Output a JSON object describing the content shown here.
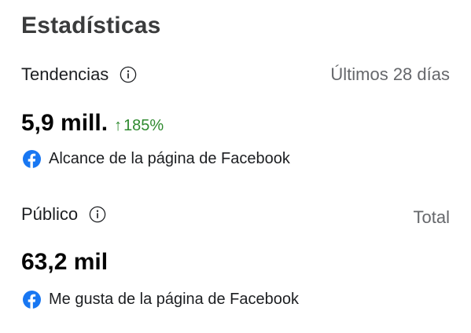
{
  "title": "Estadísticas",
  "trends": {
    "label": "Tendencias",
    "range": "Últimos 28 días",
    "value": "5,9 mill.",
    "delta_arrow": "↑",
    "delta": "185%",
    "source": "Alcance de la página de Facebook",
    "delta_color": "#2f8a2f"
  },
  "audience": {
    "label": "Público",
    "range": "Total",
    "value": "63,2 mil",
    "source": "Me gusta de la página de Facebook"
  },
  "colors": {
    "facebook_blue": "#1877f2",
    "muted_text": "#65676b"
  }
}
